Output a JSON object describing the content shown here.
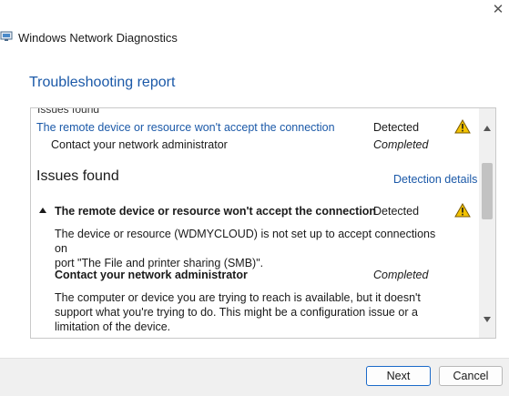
{
  "window": {
    "title": "Windows Network Diagnostics",
    "close_glyph": "✕"
  },
  "page": {
    "heading": "Troubleshooting report"
  },
  "report": {
    "cut_off_heading": "Issues found",
    "summary_issue": {
      "label": "The remote device or resource won't accept the connection",
      "status": "Detected",
      "icon": "warning-icon"
    },
    "summary_action": {
      "label": "Contact your network administrator",
      "status": "Completed"
    },
    "section_title": "Issues found",
    "details_link": "Detection details",
    "issue": {
      "title": "The remote device or resource won't accept the connection",
      "status": "Detected",
      "icon": "warning-icon",
      "description_line1": "The device or resource (WDMYCLOUD) is not set up to accept connections on",
      "description_line2": "port \"The File and printer sharing (SMB)\"."
    },
    "action": {
      "title": "Contact your network administrator",
      "status": "Completed",
      "description_line1": "The computer or device you are trying to reach is available, but it doesn't",
      "description_line2": "support what you're trying to do. This might be a configuration issue or a",
      "description_line3": "limitation of the device."
    }
  },
  "footer": {
    "next_label": "Next",
    "cancel_label": "Cancel"
  },
  "colors": {
    "link": "#1b59a8",
    "warning": "#f2c200",
    "primary_button_border": "#1b6ac9"
  }
}
